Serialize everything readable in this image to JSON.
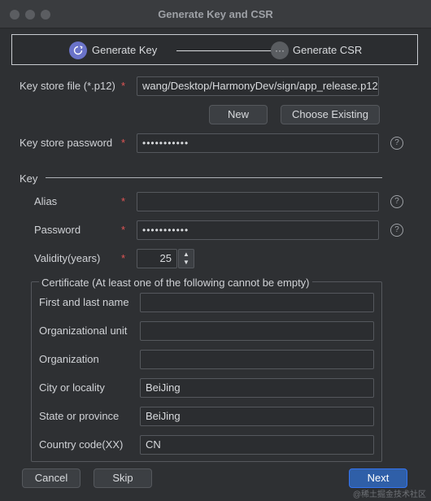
{
  "window": {
    "title": "Generate Key and CSR"
  },
  "steps": [
    {
      "label": "Generate Key",
      "icon": "refresh-icon"
    },
    {
      "label": "Generate CSR",
      "icon": "ellipsis-icon"
    }
  ],
  "keystore": {
    "file_label": "Key store file (*.p12)",
    "file_value": "wang/Desktop/HarmonyDev/sign/app_release.p12",
    "new_button": "New",
    "choose_button": "Choose Existing",
    "password_label": "Key store password",
    "password_value": "•••••••••••"
  },
  "key": {
    "section_label": "Key",
    "alias_label": "Alias",
    "alias_value": "",
    "password_label": "Password",
    "password_value": "•••••••••••",
    "validity_label": "Validity(years)",
    "validity_value": "25"
  },
  "certificate": {
    "title": "Certificate (At least one of the following cannot be empty)",
    "fields": [
      {
        "label": "First and last name",
        "value": ""
      },
      {
        "label": "Organizational unit",
        "value": ""
      },
      {
        "label": "Organization",
        "value": ""
      },
      {
        "label": "City or locality",
        "value": "BeiJing"
      },
      {
        "label": "State or province",
        "value": "BeiJing"
      },
      {
        "label": "Country code(XX)",
        "value": "CN"
      }
    ]
  },
  "footer": {
    "cancel": "Cancel",
    "skip": "Skip",
    "next": "Next"
  },
  "required_marker": "*",
  "help_glyph": "?",
  "watermark": "@稀土掘金技术社区",
  "colors": {
    "accent": "#2f5fa8",
    "required": "#e05555",
    "step_active": "#6a73c9"
  }
}
